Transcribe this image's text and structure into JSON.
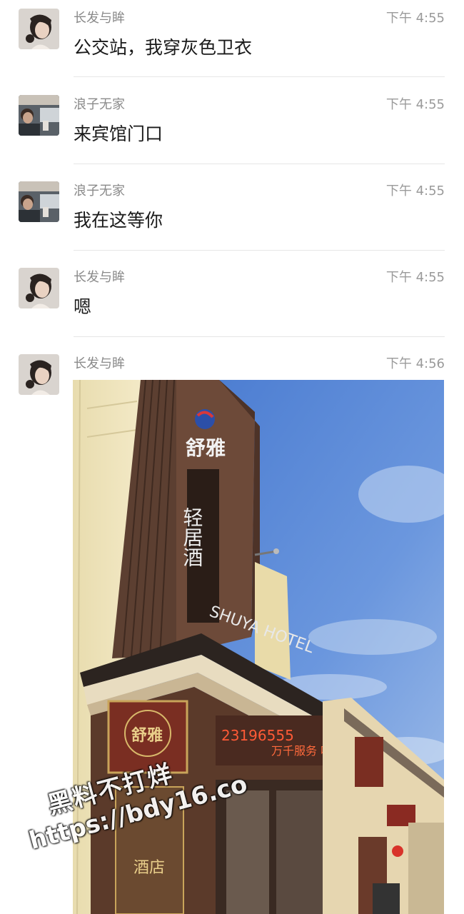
{
  "messages": [
    {
      "sender": "长发与眸",
      "time": "下午 4:55",
      "text": "公交站，我穿灰色卫衣",
      "avatar": "woman-avatar"
    },
    {
      "sender": "浪子无家",
      "time": "下午 4:55",
      "text": "来宾馆门口",
      "avatar": "man-car-avatar"
    },
    {
      "sender": "浪子无家",
      "time": "下午 4:55",
      "text": "我在这等你",
      "avatar": "man-car-avatar"
    },
    {
      "sender": "长发与眸",
      "time": "下午 4:55",
      "text": "嗯",
      "avatar": "woman-avatar"
    },
    {
      "sender": "长发与眸",
      "time": "下午 4:56",
      "image": "hotel-photo",
      "avatar": "woman-avatar"
    }
  ],
  "photo": {
    "sign_brand": "舒雅",
    "sign_vertical": "轻居酒",
    "sign_english": "SHUYA HOTEL",
    "phone_banner": "23196555",
    "banner_text": "万千服务 响亮",
    "door_sign": "舒雅",
    "door_sign_lower": "酒店"
  },
  "watermark": {
    "line1": "黑料不打烊",
    "line2": "https://bdy16.co"
  },
  "colors": {
    "sky": "#5a86d6",
    "building_wall": "#efe3b8",
    "brown_panel": "#6a4a3a",
    "text_primary": "#1a1a1a",
    "text_muted": "#8a8a8a"
  }
}
